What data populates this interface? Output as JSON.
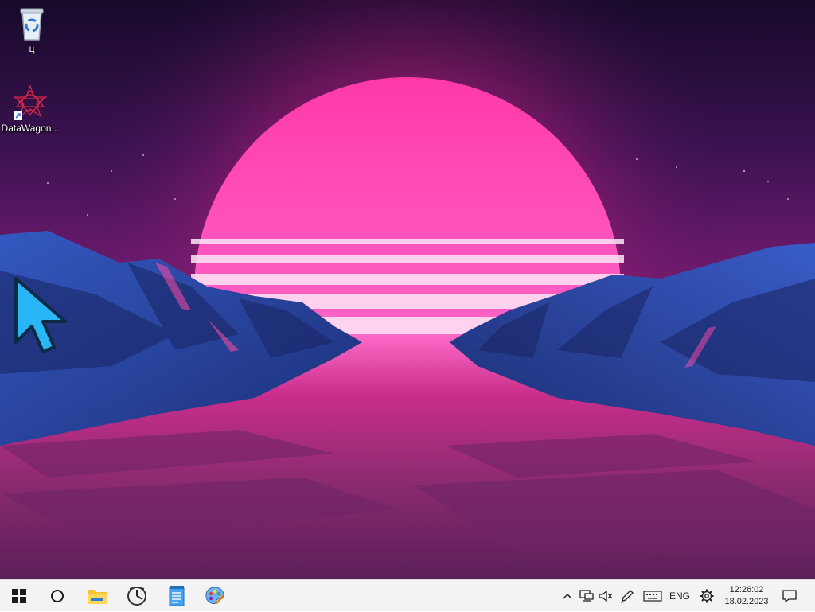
{
  "desktop": {
    "icons": [
      {
        "label": "ц",
        "icon": "recycle-bin-icon"
      },
      {
        "label": "DataWagon...",
        "icon": "datawagon-app-icon",
        "shortcut": true
      }
    ],
    "wallpaper": "synthwave-sunset-mountains"
  },
  "taskbar": {
    "start_icon": "windows-start-icon",
    "search_icon": "search-circle-icon",
    "pinned": [
      {
        "icon": "file-explorer-icon"
      },
      {
        "icon": "clock-app-icon"
      },
      {
        "icon": "notepad-icon"
      },
      {
        "icon": "paint-icon"
      }
    ],
    "tray": {
      "chevron_icon": "chevron-up-icon",
      "network_icon": "network-icon",
      "volume_icon": "volume-muted-icon",
      "pen_icon": "pen-icon",
      "keyboard_icon": "keyboard-icon",
      "language": "ENG",
      "settings_icon": "gear-icon"
    },
    "clock": {
      "time": "12:26:02",
      "date": "18.02.2023"
    },
    "notifications_icon": "notification-icon"
  },
  "colors": {
    "taskbar_bg": "#f3f3f3",
    "sun": "#ff3fb0",
    "mountains": "#2a4aa8",
    "cursor": "#29b6f6"
  }
}
